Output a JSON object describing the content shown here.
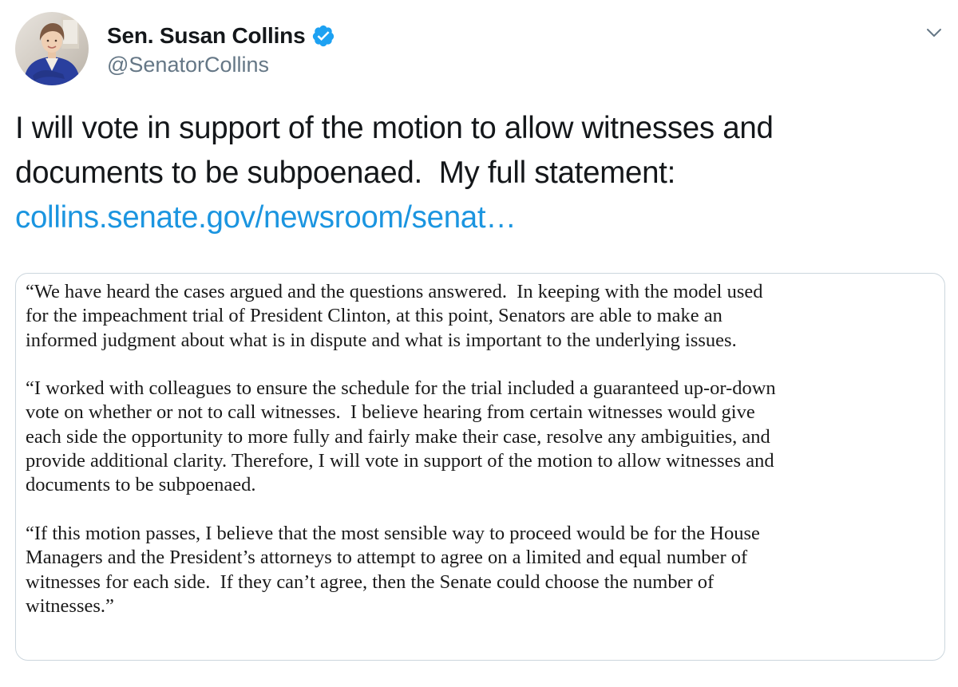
{
  "author": {
    "display_name": "Sen. Susan Collins",
    "handle": "@SenatorCollins",
    "verified": true,
    "avatar_icon": "profile-photo"
  },
  "menu": {
    "icon": "chevron-down-icon"
  },
  "tweet": {
    "text_lines": [
      "I will vote in support of the motion to allow witnesses and",
      "documents to be subpoenaed.  My full statement:"
    ],
    "link_text": "collins.senate.gov/newsroom/senat…"
  },
  "statement_image": {
    "paragraphs": [
      [
        "“We have heard the cases argued and the questions answered.  In keeping with the model used",
        "for the impeachment trial of President Clinton, at this point, Senators are able to make an",
        "informed judgment about what is in dispute and what is important to the underlying issues."
      ],
      [
        "“I worked with colleagues to ensure the schedule for the trial included a guaranteed up-or-down",
        "vote on whether or not to call witnesses.  I believe hearing from certain witnesses would give",
        "each side the opportunity to more fully and fairly make their case, resolve any ambiguities, and",
        "provide additional clarity. Therefore, I will vote in support of the motion to allow witnesses and",
        "documents to be subpoenaed."
      ],
      [
        "“If this motion passes, I believe that the most sensible way to proceed would be for the House",
        "Managers and the President’s attorneys to attempt to agree on a limited and equal number of",
        "witnesses for each side.  If they can’t agree, then the Senate could choose the number of",
        "witnesses.”"
      ]
    ]
  },
  "colors": {
    "text": "#14171a",
    "secondary": "#657786",
    "link": "#1b95e0",
    "verified": "#1da1f2",
    "card_border": "#ccd6dd"
  }
}
